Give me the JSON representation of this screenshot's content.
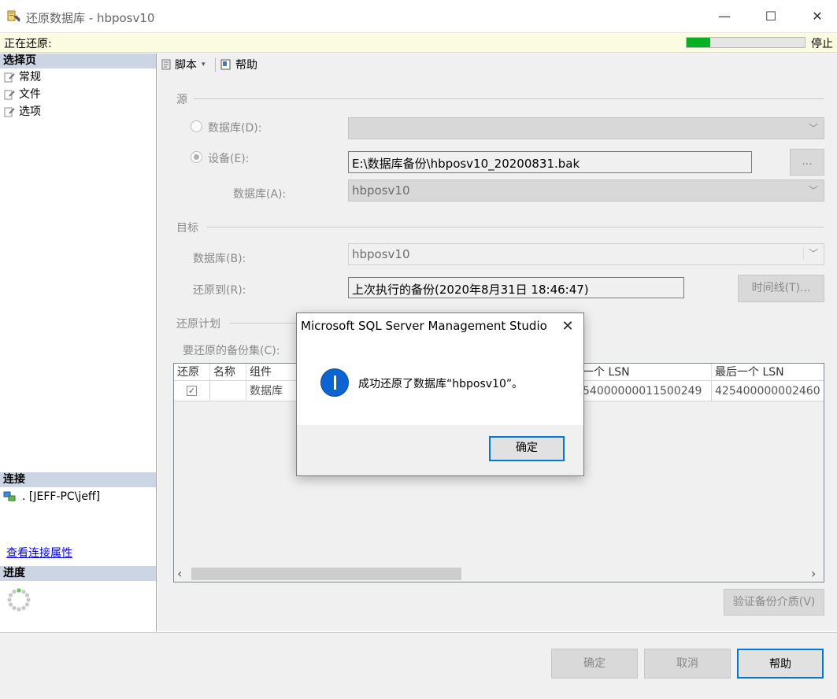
{
  "window": {
    "title": "还原数据库 - hbposv10",
    "minimize_glyph": "—",
    "maximize_glyph": "☐",
    "close_glyph": "✕"
  },
  "status": {
    "text": "正在还原:",
    "progress_fraction": 0.2,
    "stop_label": "停止",
    "progress_color": "#06b025"
  },
  "left": {
    "select_page_header": "选择页",
    "pages": [
      {
        "label": "常规",
        "icon": "page-wrench-icon"
      },
      {
        "label": "文件",
        "icon": "page-wrench-icon"
      },
      {
        "label": "选项",
        "icon": "page-wrench-icon"
      }
    ],
    "connection_header": "连接",
    "connection_text": ". [JEFF-PC\\jeff]",
    "connection_link": "查看连接属性",
    "progress_header": "进度"
  },
  "toolbar": {
    "script_label": "脚本",
    "help_label": "帮助"
  },
  "source": {
    "group_label": "源",
    "database_radio": "数据库(D):",
    "device_radio": "设备(E):",
    "device_path": "E:\\数据库备份\\hbposv10_20200831.bak",
    "browse_label": "...",
    "database_label": "数据库(A):",
    "database_value": "hbposv10"
  },
  "target": {
    "group_label": "目标",
    "database_label": "数据库(B):",
    "database_value": "hbposv10",
    "restore_to_label": "还原到(R):",
    "restore_to_value": "上次执行的备份(2020年8月31日 18:46:47)",
    "timeline_label": "时间线(T)..."
  },
  "plan": {
    "group_label": "还原计划",
    "backupsets_label": "要还原的备份集(C):",
    "columns": [
      "还原",
      "名称",
      "组件",
      "一个 LSN",
      "最后一个 LSN"
    ],
    "row": {
      "restore_checked": true,
      "name": "",
      "component": "数据库",
      "first_lsn": "54000000011500249",
      "last_lsn": "425400000002460"
    },
    "scroll_left": "‹",
    "scroll_right": "›",
    "verify_label": "验证备份介质(V)"
  },
  "buttons": {
    "ok": "确定",
    "cancel": "取消",
    "help": "帮助"
  },
  "dialog": {
    "title": "Microsoft SQL Server Management Studio",
    "close_glyph": "✕",
    "message": "成功还原了数据库“hbposv10”。",
    "ok_label": "确定",
    "icon": "info-icon",
    "info_color": "#0a64d2"
  }
}
